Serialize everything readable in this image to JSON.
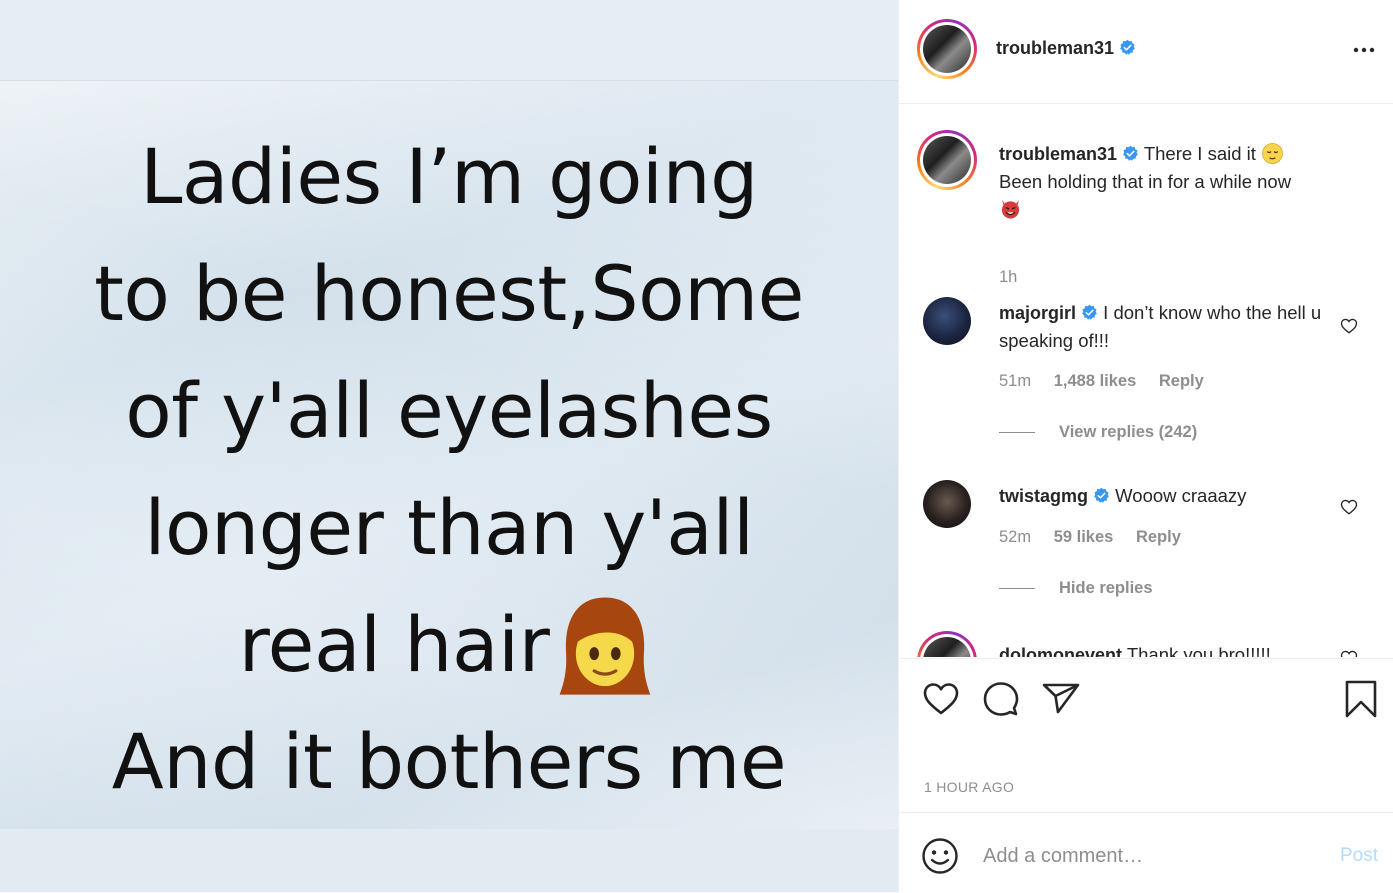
{
  "post": {
    "image_text_lines": [
      "Ladies I’m going",
      "to be honest,Some",
      "of y'all eyelashes",
      "longer than y'all",
      "real hair",
      "And it bothers me"
    ]
  },
  "header": {
    "username": "troubleman31"
  },
  "caption": {
    "username": "troubleman31",
    "text_part1": "There I said it",
    "text_part2": "Been holding that in for a while now",
    "time": "1h"
  },
  "comments": [
    {
      "username": "majorgirl",
      "text": "I don’t know who the hell u speaking of!!!",
      "time": "51m",
      "likes": "1,488 likes",
      "reply_label": "Reply",
      "replies_toggle": "View replies (242)"
    },
    {
      "username": "twistagmg",
      "text": "Wooow craaazy",
      "time": "52m",
      "likes": "59 likes",
      "reply_label": "Reply",
      "replies_toggle": "Hide replies"
    },
    {
      "username": "dolomonevent",
      "text": "Thank you bro!!!!!"
    }
  ],
  "footer": {
    "timestamp": "1 HOUR AGO",
    "comment_placeholder": "Add a comment…",
    "post_label": "Post"
  },
  "colors": {
    "verified_blue": "#3897f0",
    "post_disabled": "#b3dbff",
    "secondary_text": "#8e8e8e"
  }
}
